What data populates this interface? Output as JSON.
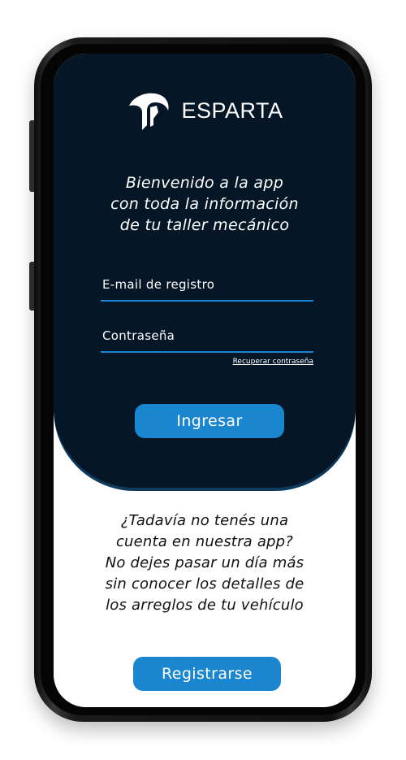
{
  "app": {
    "brand_name": "ESPARTA",
    "logo_icon": "spartan-helmet-icon"
  },
  "login": {
    "welcome_lines": [
      "Bienvenido a la app",
      "con toda la información",
      "de tu taller mecánico"
    ],
    "email_placeholder": "E-mail de registro",
    "password_placeholder": "Contraseña",
    "recover_link": "Recuperar contraseña",
    "submit_label": "Ingresar"
  },
  "signup": {
    "promo_lines": [
      "¿Tadavía no tenés una",
      "cuenta en nuestra app?",
      "No dejes pasar un día más",
      "sin conocer los detalles de",
      "los arreglos de tu vehículo"
    ],
    "button_label": "Registrarse"
  },
  "colors": {
    "panel_background": "#051626",
    "accent": "#1a86cf",
    "text_light": "#ffffff",
    "text_dark": "#111111"
  }
}
